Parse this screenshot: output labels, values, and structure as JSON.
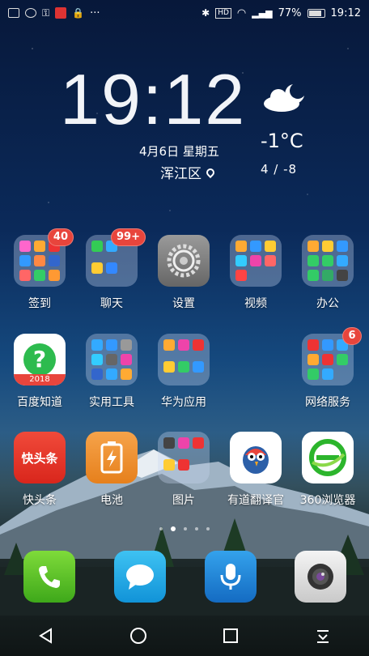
{
  "status_bar": {
    "battery": "77%",
    "time": "19:12",
    "hd": "HD"
  },
  "clock_widget": {
    "time": "19:12",
    "date": "4月6日 星期五",
    "location": "浑江区",
    "temperature": "-1°C",
    "range": "4 / -8",
    "weather_icon": "cloudy-night-icon"
  },
  "apps": [
    {
      "label": "签到",
      "badge": "40"
    },
    {
      "label": "聊天",
      "badge": "99+"
    },
    {
      "label": "设置"
    },
    {
      "label": "视频"
    },
    {
      "label": "办公"
    },
    {
      "label": "百度知道",
      "tile_text": "2018"
    },
    {
      "label": "实用工具"
    },
    {
      "label": "华为应用"
    },
    {
      "label": "网络服务",
      "badge": "6"
    },
    {
      "label": "快头条",
      "tile_text": "快头条"
    },
    {
      "label": "电池"
    },
    {
      "label": "图片"
    },
    {
      "label": "有道翻译官"
    },
    {
      "label": "360浏览器"
    }
  ],
  "page_indicator": {
    "pages": 5,
    "current": 2
  },
  "dock": [
    "phone-icon",
    "messages-icon",
    "voice-assistant-icon",
    "camera-icon"
  ],
  "nav": [
    "back-icon",
    "home-icon",
    "recents-icon",
    "notification-pull-icon"
  ]
}
